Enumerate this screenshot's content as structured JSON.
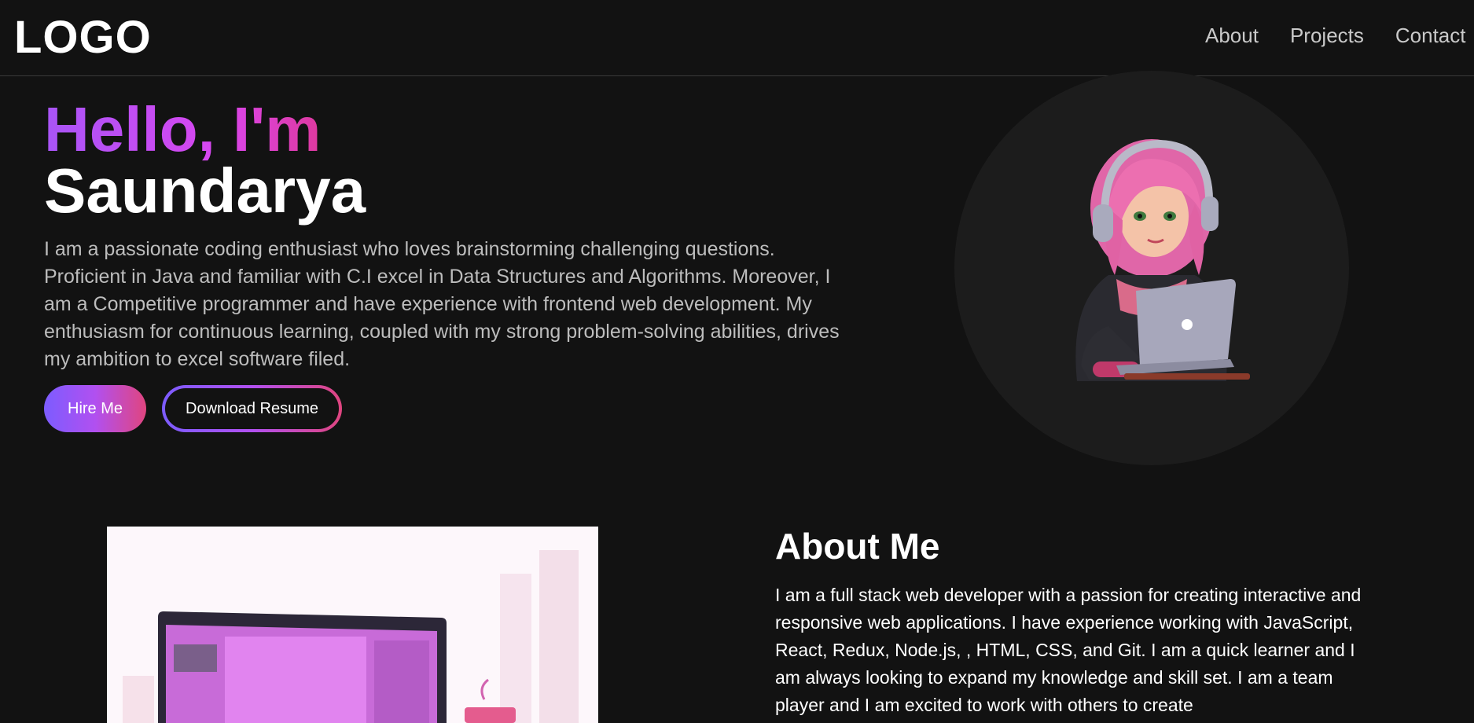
{
  "navbar": {
    "logo": "LOGO",
    "links": [
      "About",
      "Projects",
      "Contact"
    ]
  },
  "hero": {
    "greeting": "Hello, I'm",
    "name": "Saundarya",
    "description": "I am a passionate coding enthusiast who loves brainstorming challenging questions. Proficient in Java and familiar with C.I excel in Data Structures and Algorithms. Moreover, I am a Competitive programmer and have experience with frontend web development. My enthusiasm for continuous learning, coupled with my strong problem-solving abilities, drives my ambition to excel software filed.",
    "hire_button": "Hire Me",
    "resume_button": "Download Resume"
  },
  "about": {
    "title": "About Me",
    "text": "I am a full stack web developer with a passion for creating interactive and responsive web applications. I have experience working with JavaScript, React, Redux, Node.js, , HTML, CSS, and Git. I am a quick learner and I am always looking to expand my knowledge and skill set. I am a team player and I am excited to work with others to create"
  },
  "colors": {
    "background": "#121212",
    "accent_purple": "#a855f7",
    "accent_pink": "#e0337a",
    "nav_text": "#c9c9c9"
  },
  "icons": {
    "avatar": "girl-with-laptop-avatar",
    "about_image": "laptop-illustration"
  }
}
